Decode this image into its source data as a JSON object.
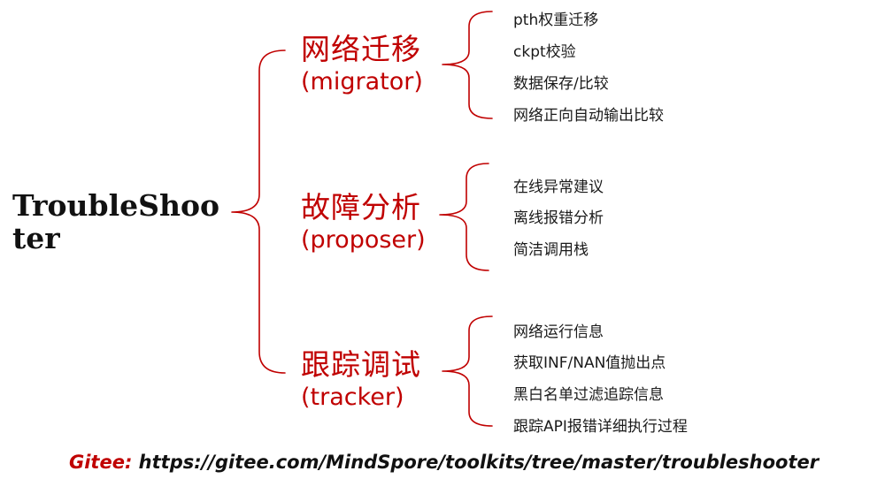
{
  "root": {
    "title": "TroubleShooter"
  },
  "categories": [
    {
      "name_zh": "网络迁移",
      "name_en": "(migrator)",
      "items": [
        "pth权重迁移",
        "ckpt校验",
        "数据保存/比较",
        "网络正向自动输出比较"
      ]
    },
    {
      "name_zh": "故障分析",
      "name_en": "(proposer)",
      "items": [
        "在线异常建议",
        "离线报错分析",
        "简洁调用栈"
      ]
    },
    {
      "name_zh": "跟踪调试",
      "name_en": "(tracker)",
      "items": [
        "网络运行信息",
        "获取INF/NAN值抛出点",
        "黑白名单过滤追踪信息",
        "跟踪API报错详细执行过程"
      ]
    }
  ],
  "footer": {
    "label": "Gitee:",
    "url": "https://gitee.com/MindSpore/toolkits/tree/master/troubleshooter"
  },
  "colors": {
    "accent": "#c00000",
    "text": "#111111"
  }
}
